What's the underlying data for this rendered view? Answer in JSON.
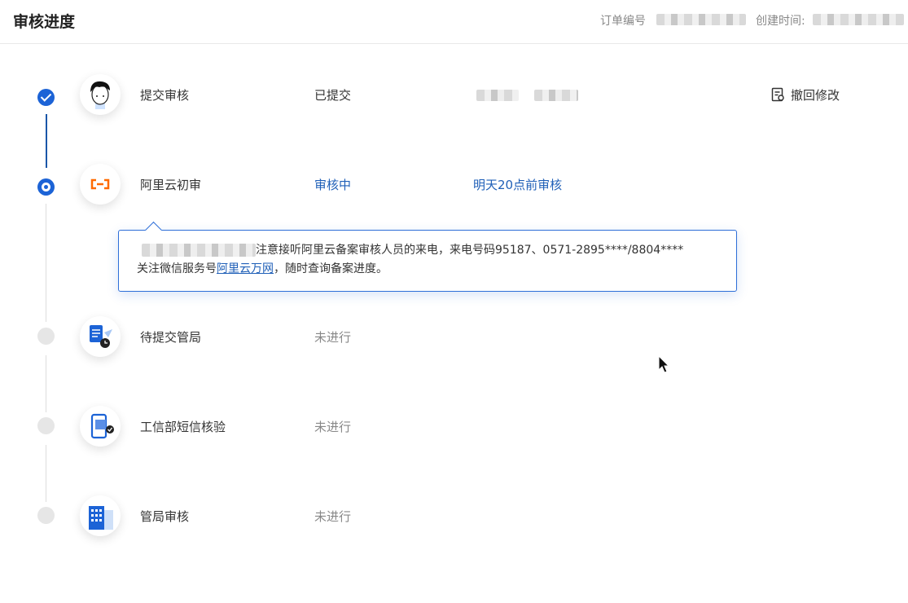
{
  "header": {
    "title": "审核进度",
    "order_label": "订单编号",
    "created_label": "创建时间:"
  },
  "steps": [
    {
      "name": "提交审核",
      "status": "已提交",
      "state": "done",
      "icon": "user-avatar-icon"
    },
    {
      "name": "阿里云初审",
      "status": "审核中",
      "note": "明天20点前审核",
      "state": "active",
      "icon": "aliyun-logo-icon"
    },
    {
      "name": "待提交管局",
      "status": "未进行",
      "state": "pending",
      "icon": "document-clock-icon"
    },
    {
      "name": "工信部短信核验",
      "status": "未进行",
      "state": "pending",
      "icon": "phone-verify-icon"
    },
    {
      "name": "管局审核",
      "status": "未进行",
      "state": "pending",
      "icon": "building-icon"
    }
  ],
  "revoke": {
    "label": "撤回修改",
    "icon": "document-edit-icon"
  },
  "tooltip": {
    "line1": "注意接听阿里云备案审核人员的来电，来电号码95187、0571-2895****/8804****",
    "line2_prefix": "关注微信服务号",
    "line2_link": "阿里云万网",
    "line2_suffix": "，随时查询备案进度。"
  },
  "colors": {
    "accent": "#1c63d6",
    "link": "#2060b8",
    "pending": "#e6e6e6",
    "muted": "#888888"
  }
}
